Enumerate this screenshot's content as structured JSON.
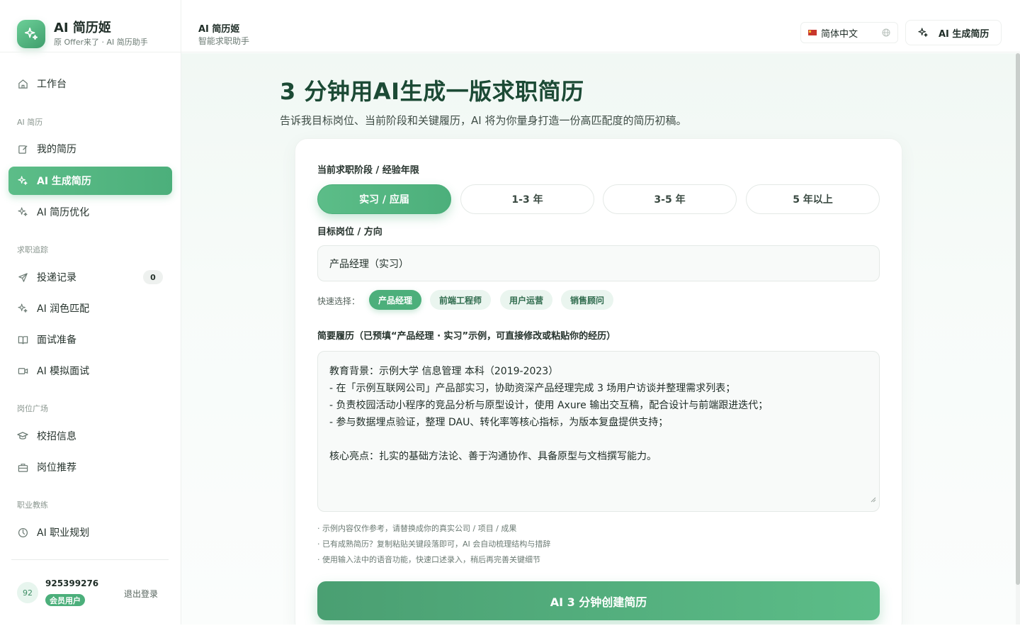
{
  "brand": {
    "title": "AI 简历姬",
    "subtitle": "原 Offer来了 · AI 简历助手"
  },
  "sidebar": {
    "workbench": "工作台",
    "sections": {
      "resume": "AI 简历",
      "tracking": "求职追踪",
      "jobs": "岗位广场",
      "coach": "职业教练"
    },
    "items": {
      "my_resume": "我的简历",
      "ai_generate": "AI 生成简历",
      "ai_optimize": "AI 简历优化",
      "applications": "投递记录",
      "applications_count": "0",
      "ai_polish": "AI 润色匹配",
      "interview_prep": "面试准备",
      "mock_interview": "AI 模拟面试",
      "campus": "校招信息",
      "job_recommend": "岗位推荐",
      "career_plan": "AI 职业规划"
    },
    "user": {
      "avatar": "92",
      "name": "925399276",
      "tag": "会员用户",
      "logout": "退出登录"
    }
  },
  "header": {
    "title": "AI 简历姬",
    "subtitle": "智能求职助手",
    "language": "简体中文",
    "action_button": "AI 生成简历"
  },
  "main": {
    "title": "3 分钟用AI生成一版求职简历",
    "subtitle": "告诉我目标岗位、当前阶段和关键履历，AI 将为你量身打造一份高匹配度的简历初稿。",
    "stage_label": "当前求职阶段 / 经验年限",
    "stages": [
      "实习 / 应届",
      "1-3 年",
      "3-5 年",
      "5 年以上"
    ],
    "selected_stage": "实习 / 应届",
    "role_label": "目标岗位 / 方向",
    "role_value": "产品经理（实习）",
    "quick_label": "快速选择：",
    "quick_chips": [
      "产品经理",
      "前端工程师",
      "用户运营",
      "销售顾问"
    ],
    "resume_label": "简要履历（已预填“产品经理 · 实习”示例，可直接修改或粘贴你的经历）",
    "resume_lines": [
      "教育背景：示例大学 信息管理 本科（2019-2023）",
      "- 在「示例互联网公司」产品部实习，协助资深产品经理完成 3 场用户访谈并整理需求列表；",
      "- 负责校园活动小程序的竞品分析与原型设计，使用 Axure 输出交互稿，配合设计与前端跟进迭代；",
      "- 参与数据埋点验证，整理 DAU、转化率等核心指标，为版本复盘提供支持；",
      "",
      "核心亮点：扎实的基础方法论、善于沟通协作、具备原型与文档撰写能力。"
    ],
    "hints": [
      "· 示例内容仅作参考，请替换成你的真实公司 / 项目 / 成果",
      "· 已有成熟简历？复制粘贴关键段落即可，AI 会自动梳理结构与措辞",
      "· 使用输入法中的语音功能，快速口述录入，稍后再完善关键细节"
    ],
    "submit": "AI 3 分钟创建简历"
  },
  "colors": {
    "accent": "#4caf7b",
    "title": "#1c4a35"
  }
}
